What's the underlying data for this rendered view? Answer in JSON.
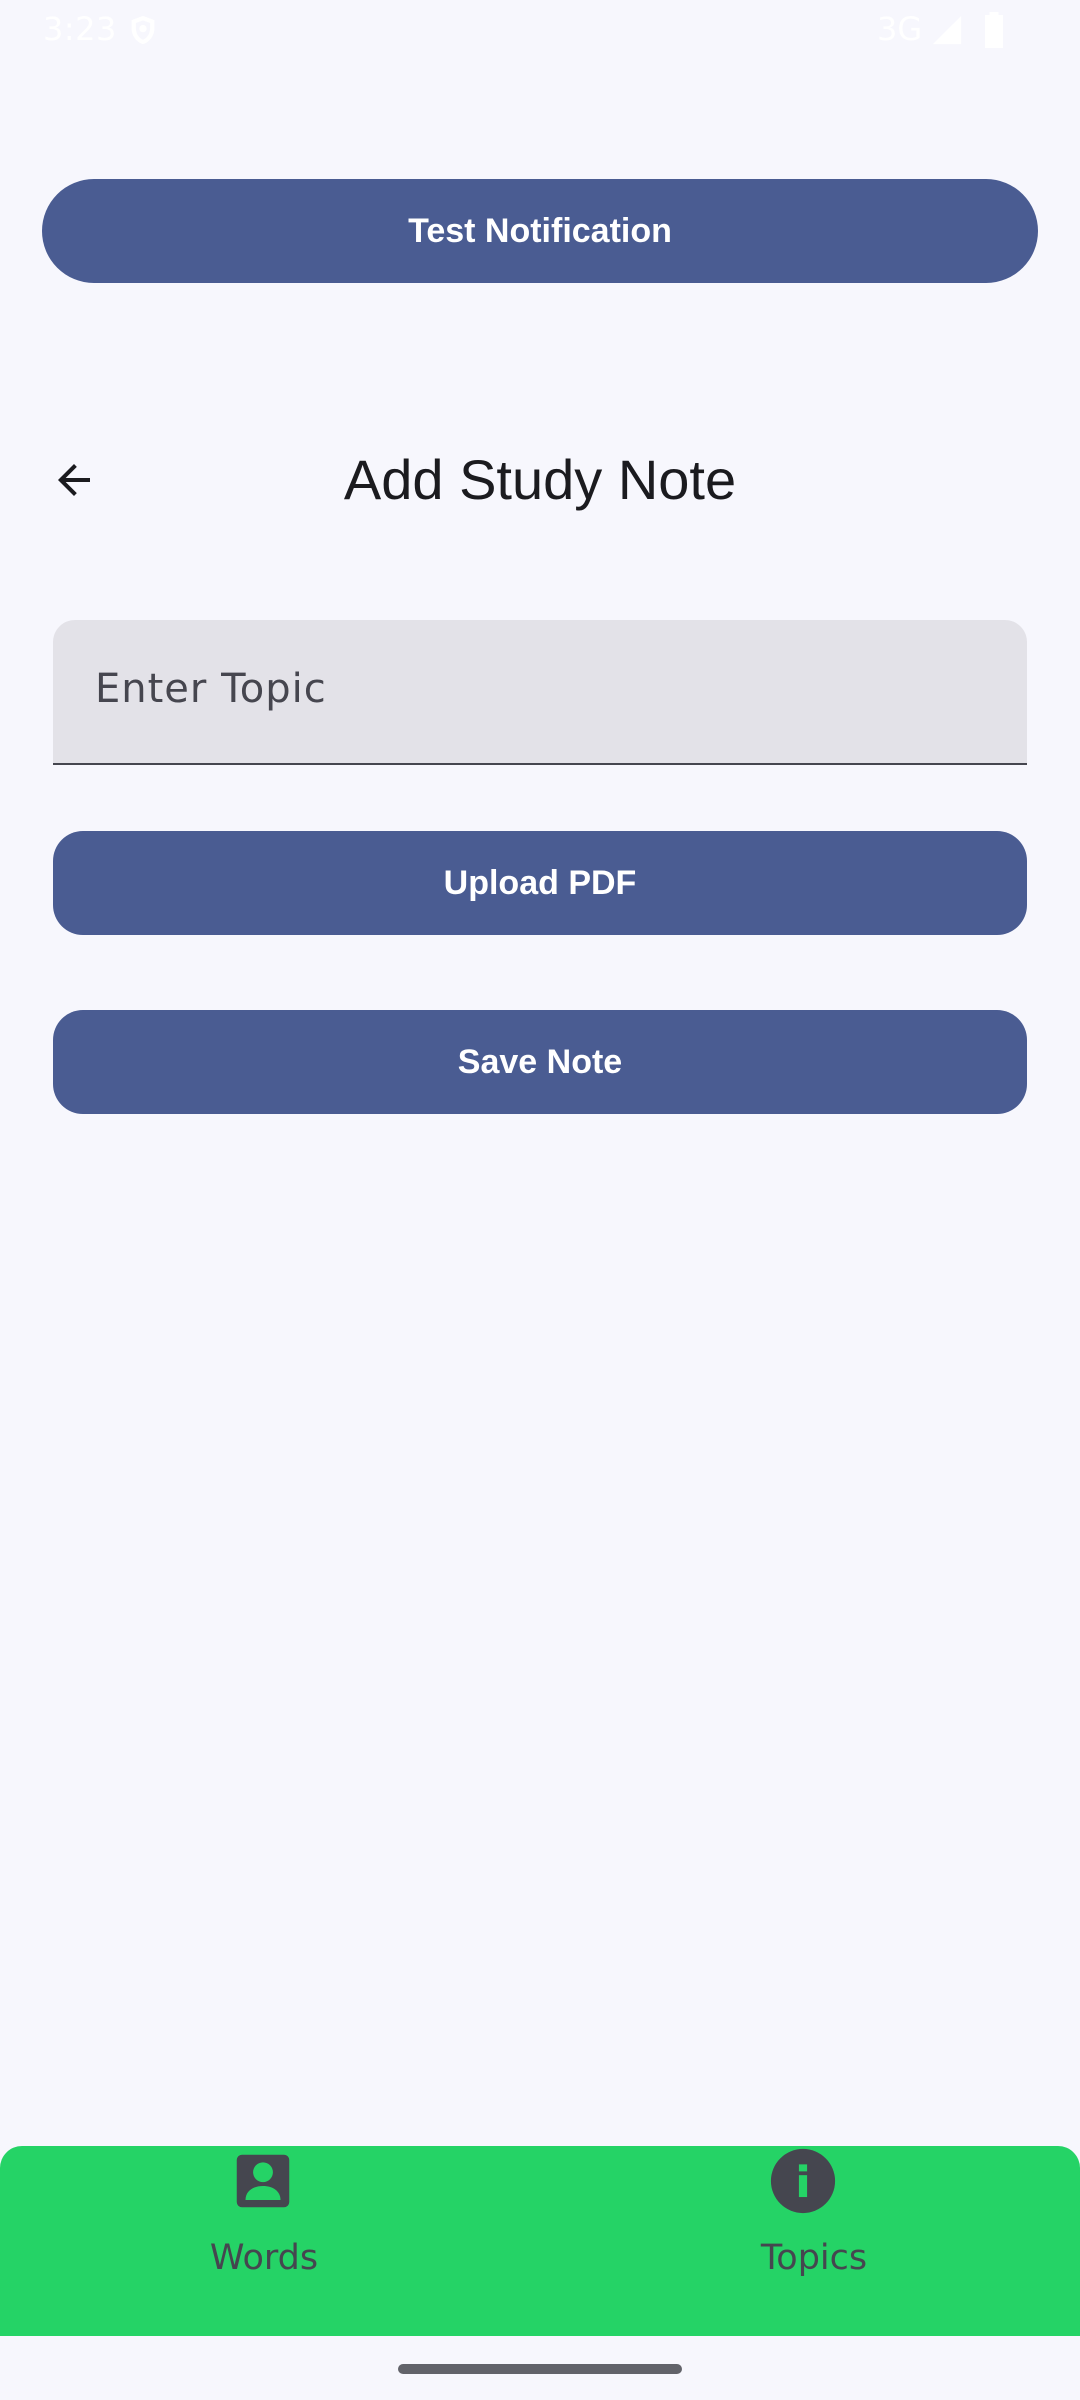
{
  "status_bar": {
    "time": "3:23",
    "network": "3G"
  },
  "actions": {
    "test_notification_label": "Test Notification"
  },
  "header": {
    "title": "Add Study Note",
    "back_icon": "arrow-back-icon"
  },
  "form": {
    "topic_placeholder": "Enter Topic",
    "topic_value": "",
    "upload_label": "Upload PDF",
    "save_label": "Save Note"
  },
  "bottom_nav": {
    "background_color": "#25D366",
    "items": [
      {
        "label": "Words",
        "icon": "person-icon"
      },
      {
        "label": "Topics",
        "icon": "info-icon"
      }
    ]
  },
  "colors": {
    "button_background": "#4A5C92",
    "page_background": "#F7F7FD",
    "input_background": "#E3E2E8"
  }
}
